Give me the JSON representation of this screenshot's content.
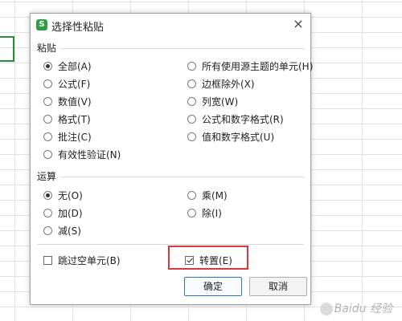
{
  "dialog": {
    "title": "选择性粘贴",
    "app_icon": "S",
    "close_label": "×"
  },
  "paste": {
    "label": "粘贴",
    "left": [
      {
        "label": "全部(A)",
        "checked": true
      },
      {
        "label": "公式(F)",
        "checked": false
      },
      {
        "label": "数值(V)",
        "checked": false
      },
      {
        "label": "格式(T)",
        "checked": false
      },
      {
        "label": "批注(C)",
        "checked": false
      },
      {
        "label": "有效性验证(N)",
        "checked": false
      }
    ],
    "right": [
      {
        "label": "所有使用源主题的单元(H)",
        "checked": false
      },
      {
        "label": "边框除外(X)",
        "checked": false
      },
      {
        "label": "列宽(W)",
        "checked": false
      },
      {
        "label": "公式和数字格式(R)",
        "checked": false
      },
      {
        "label": "值和数字格式(U)",
        "checked": false
      }
    ]
  },
  "operation": {
    "label": "运算",
    "left": [
      {
        "label": "无(O)",
        "checked": true
      },
      {
        "label": "加(D)",
        "checked": false
      },
      {
        "label": "减(S)",
        "checked": false
      }
    ],
    "right": [
      {
        "label": "乘(M)",
        "checked": false
      },
      {
        "label": "除(I)",
        "checked": false
      }
    ]
  },
  "options": {
    "skip_blanks": {
      "label": "跳过空单元(B)",
      "checked": false
    },
    "transpose": {
      "label": "转置(E)",
      "checked": true
    }
  },
  "buttons": {
    "ok": "确定",
    "cancel": "取消"
  },
  "watermark": "Baidu 经验",
  "colors": {
    "accent_green": "#2ea043",
    "highlight_red": "#d9363e",
    "primary_border": "#2a74c9"
  }
}
